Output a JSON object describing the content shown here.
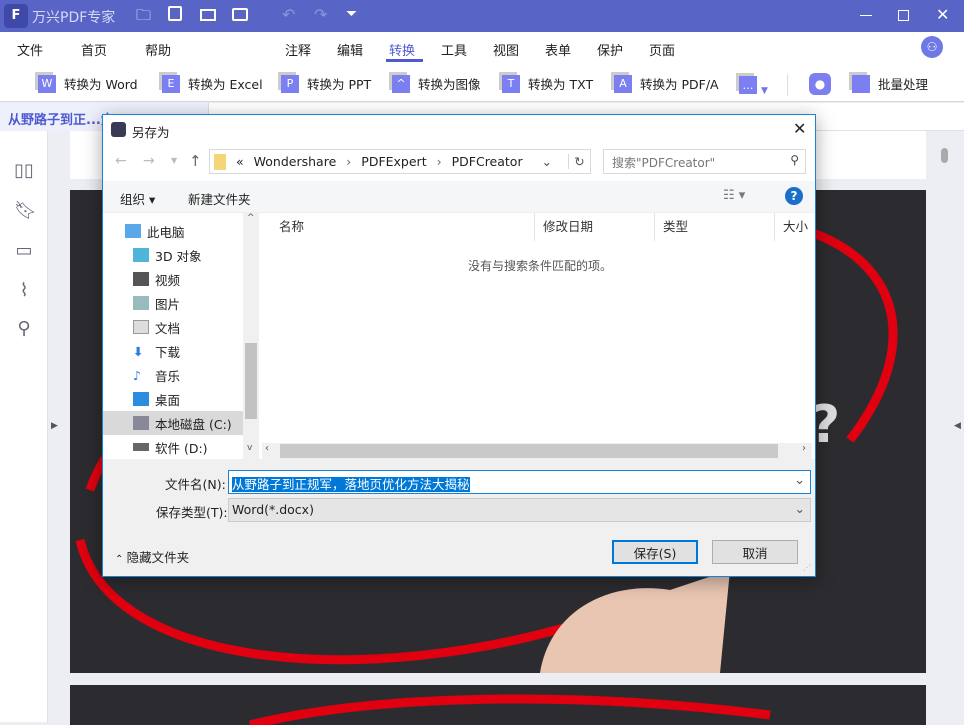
{
  "app": {
    "title": "万兴PDF专家"
  },
  "menu": [
    "文件",
    "首页",
    "帮助",
    "注释",
    "编辑",
    "转换",
    "工具",
    "视图",
    "表单",
    "保护",
    "页面"
  ],
  "active_menu": "转换",
  "toolbar": [
    {
      "icon": "W",
      "label": "转换为 Word"
    },
    {
      "icon": "E",
      "label": "转换为 Excel"
    },
    {
      "icon": "P",
      "label": "转换为 PPT"
    },
    {
      "icon": "^",
      "label": "转换为图像"
    },
    {
      "icon": "T",
      "label": "转换为 TXT"
    },
    {
      "icon": "A",
      "label": "转换为 PDF/A"
    }
  ],
  "batch_label": "批量处理",
  "doc_tab": "从野路子到正...大",
  "page_text": "?",
  "dialog": {
    "title": "另存为",
    "breadcrumb": [
      "«",
      "Wondershare",
      "PDFExpert",
      "PDFCreator"
    ],
    "search_placeholder": "搜索\"PDFCreator\"",
    "organize": "组织 ▾",
    "new_folder": "新建文件夹",
    "nav": [
      "此电脑",
      "3D 对象",
      "视频",
      "图片",
      "文档",
      "下载",
      "音乐",
      "桌面",
      "本地磁盘 (C:)",
      "软件 (D:)"
    ],
    "columns": [
      "名称",
      "修改日期",
      "类型",
      "大小"
    ],
    "empty_message": "没有与搜索条件匹配的项。",
    "filename_label": "文件名(N):",
    "filename_value": "从野路子到正规军，落地页优化方法大揭秘",
    "filetype_label": "保存类型(T):",
    "filetype_value": "Word(*.docx)",
    "hide_folders": "隐藏文件夹",
    "save": "保存(S)",
    "cancel": "取消"
  },
  "colors": {
    "brand": "#5965c6",
    "accent": "#1883d7",
    "red": "#e00010"
  }
}
